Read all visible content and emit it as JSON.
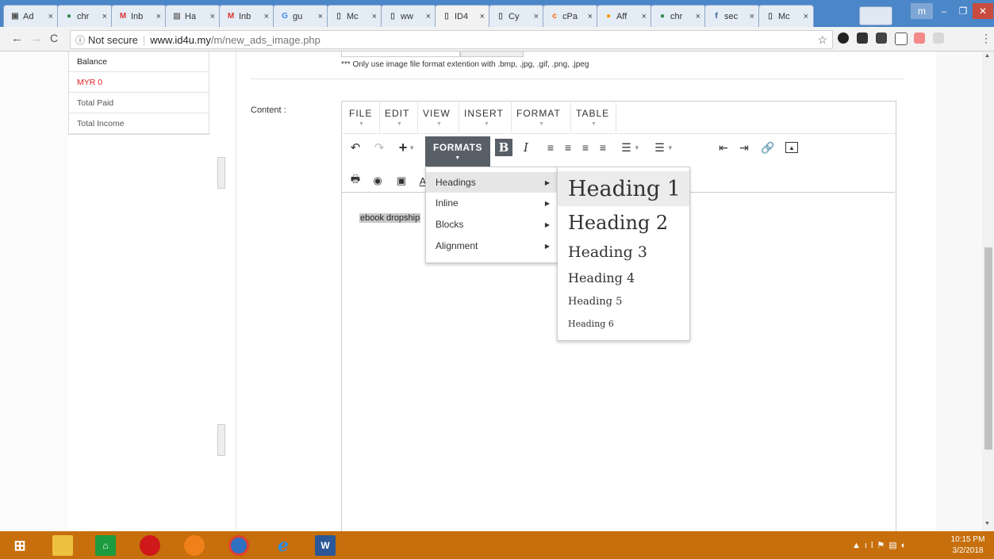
{
  "browser": {
    "tabs": [
      {
        "label": "Ad",
        "icon": "doc-icon"
      },
      {
        "label": "chr",
        "icon": "chrome-icon"
      },
      {
        "label": "Inb",
        "icon": "gmail-icon"
      },
      {
        "label": "Ha",
        "icon": "image-icon"
      },
      {
        "label": "Inb",
        "icon": "gmail-icon"
      },
      {
        "label": "gu",
        "icon": "google-icon"
      },
      {
        "label": "Mc",
        "icon": "page-icon"
      },
      {
        "label": "ww",
        "icon": "page-icon"
      },
      {
        "label": "ID4",
        "icon": "page-icon"
      },
      {
        "label": "Cy",
        "icon": "page-icon"
      },
      {
        "label": "cPa",
        "icon": "cpanel-icon"
      },
      {
        "label": "Aff",
        "icon": "aff-icon"
      },
      {
        "label": "chr",
        "icon": "chrome-icon"
      },
      {
        "label": "sec",
        "icon": "facebook-icon"
      },
      {
        "label": "Mc",
        "icon": "page-icon"
      }
    ],
    "tab_close": "×",
    "security": "Not secure",
    "url_domain": "www.id4u.my",
    "url_path": "/m/new_ads_image.php"
  },
  "sidebar": {
    "rows": [
      {
        "label": "Balance",
        "color": "#222222"
      },
      {
        "label": "MYR 0",
        "color": "#e02020"
      },
      {
        "label": "Total Paid",
        "color": "#555555"
      },
      {
        "label": "Total Income",
        "color": "#555555"
      }
    ]
  },
  "form": {
    "image_note": "*** Only use image file format extention with .bmp, .jpg, .gif, .png, .jpeg",
    "content_label": "Content :"
  },
  "editor": {
    "menus": [
      "FILE",
      "EDIT",
      "VIEW",
      "INSERT",
      "FORMAT",
      "TABLE"
    ],
    "formats_label": "FORMATS",
    "body_text": "ebook dropship",
    "formats_menu": [
      "Headings",
      "Inline",
      "Blocks",
      "Alignment"
    ],
    "headings_menu": [
      "Heading 1",
      "Heading 2",
      "Heading 3",
      "Heading 4",
      "Heading 5",
      "Heading 6"
    ]
  },
  "taskbar": {
    "time": "10:15 PM",
    "date": "3/2/2018"
  },
  "colors": {
    "tabstrip": "#4a86c8",
    "taskbar": "#c66f0c",
    "formats_button": "#595f66",
    "selected_text_bg": "#c8c8c8"
  }
}
